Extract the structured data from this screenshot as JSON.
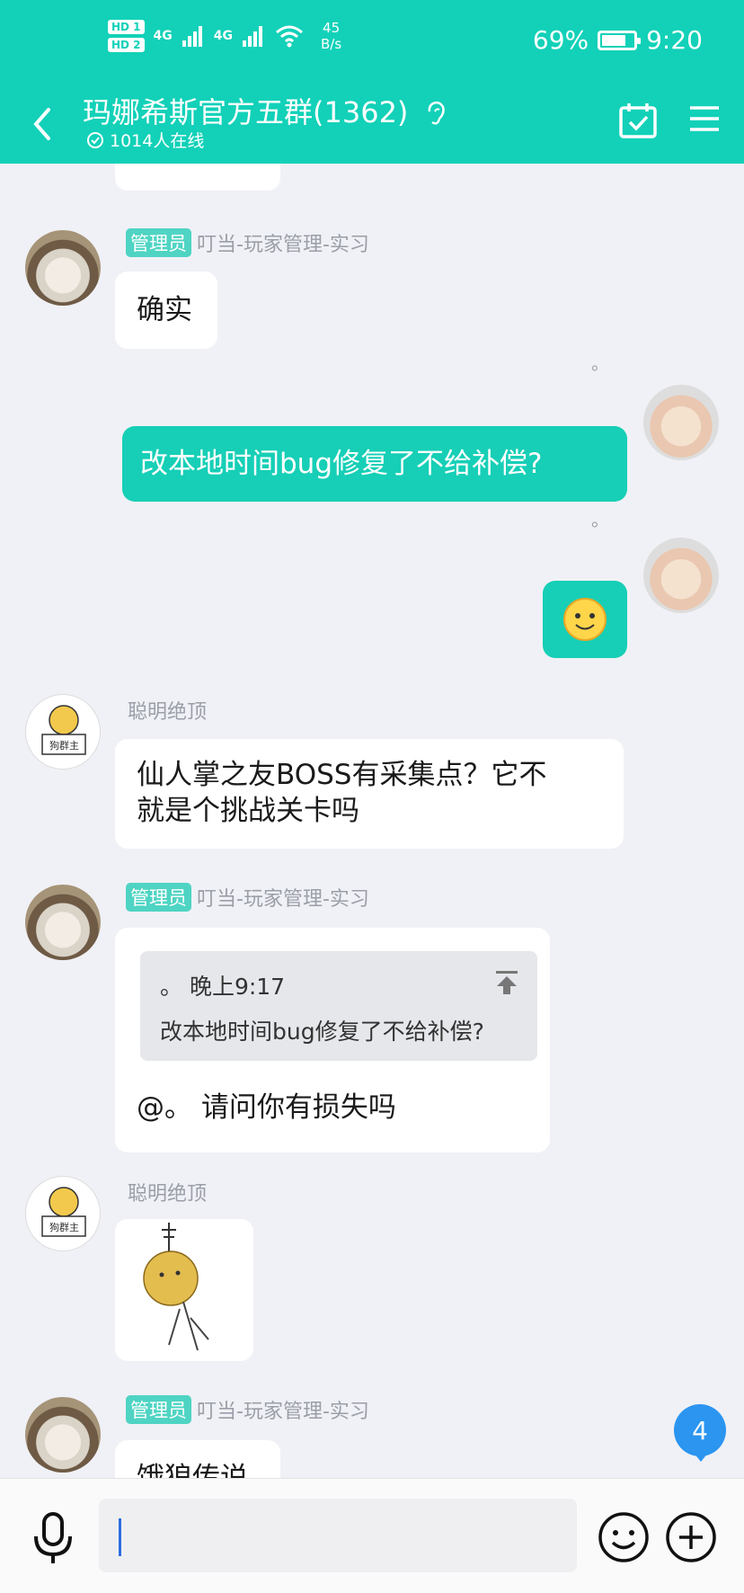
{
  "status_bar": {
    "hd1": "HD 1",
    "hd2": "HD 2",
    "net1": "4G",
    "net2": "4G",
    "speed_value": "45",
    "speed_unit": "B/s",
    "battery_percent": "69%",
    "battery_level": 0.69,
    "time": "9:20"
  },
  "header": {
    "title": "玛娜希斯官方五群(1362)",
    "online": "1014人在线"
  },
  "messages": [
    {
      "sender_badge": "管理员",
      "sender_name": "叮当-玩家管理-实习",
      "text": "确实"
    },
    {
      "mine": true,
      "name": "。",
      "text": "改本地时间bug修复了不给补偿?"
    },
    {
      "mine": true,
      "name": "。",
      "sticker": "smiley"
    },
    {
      "sender_name": "聪明绝顶",
      "avatar_label": "狗群主",
      "text_line1": "仙人掌之友BOSS有采集点？它不",
      "text_line2": "就是个挑战关卡吗"
    },
    {
      "sender_badge": "管理员",
      "sender_name": "叮当-玩家管理-实习",
      "quote_header": "。 晚上9:17",
      "quote_text": "改本地时间bug修复了不给补偿?",
      "text": "@。 请问你有损失吗"
    },
    {
      "sender_name": "聪明绝顶",
      "avatar_label": "狗群主",
      "image": "hanging-cartoon-sticker"
    },
    {
      "sender_badge": "管理员",
      "sender_name": "叮当-玩家管理-实习",
      "text": "饿狼传说"
    }
  ],
  "unread_count": "4",
  "colors": {
    "accent": "#12d1b8",
    "badge": "#4fd4c3",
    "unread": "#2b95f0"
  }
}
